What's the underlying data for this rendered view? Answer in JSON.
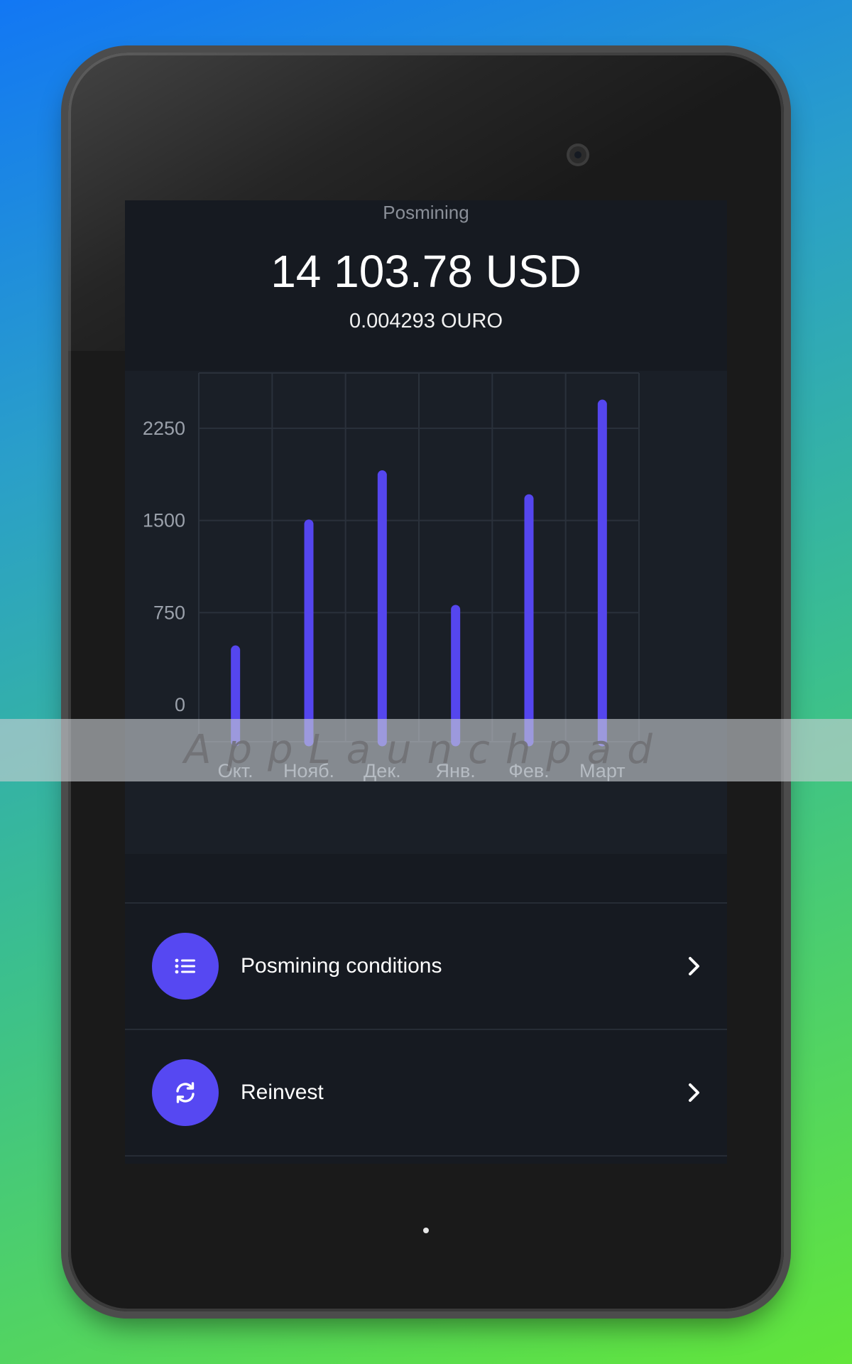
{
  "screen": {
    "title": "Posmining",
    "balance_usd": "14 103.78 USD",
    "balance_ouro": "0.004293 OURO"
  },
  "chart_data": {
    "type": "bar",
    "categories": [
      "Окт.",
      "Нояб.",
      "Дек.",
      "Янв.",
      "Фев.",
      "Март"
    ],
    "values": [
      480,
      1505,
      1905,
      810,
      1710,
      2480
    ],
    "yticks": [
      0,
      750,
      1500,
      2250
    ],
    "ylim": [
      -300,
      2700
    ],
    "grid": true,
    "bar_color": "#5546ee"
  },
  "menu": [
    {
      "label": "Posmining conditions",
      "icon": "list-icon"
    },
    {
      "label": "Reinvest",
      "icon": "refresh-icon"
    }
  ],
  "watermark": "AppLaunchpad"
}
